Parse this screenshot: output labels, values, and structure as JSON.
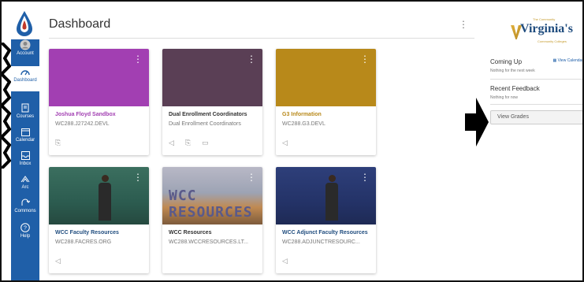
{
  "header": {
    "title": "Dashboard"
  },
  "nav": {
    "items": [
      {
        "label": "Account",
        "icon": "account-icon"
      },
      {
        "label": "Dashboard",
        "icon": "dashboard-icon"
      },
      {
        "label": "Courses",
        "icon": "courses-icon"
      },
      {
        "label": "Calendar",
        "icon": "calendar-icon"
      },
      {
        "label": "Inbox",
        "icon": "inbox-icon"
      },
      {
        "label": "Arc",
        "icon": "arc-icon"
      },
      {
        "label": "Commons",
        "icon": "commons-icon"
      },
      {
        "label": "Help",
        "icon": "help-icon"
      }
    ]
  },
  "cards": [
    {
      "name": "Joshua Floyd Sandbox",
      "code": "WC288.J27242.DEVL",
      "color": "#a23fb2",
      "name_color": "#a23fb2"
    },
    {
      "name": "Dual Enrollment Coordinators",
      "code": "Dual Enrollment Coordinators",
      "color": "#5a3f55",
      "name_color": "#333333"
    },
    {
      "name": "G3 Information",
      "code": "WC288.G3.DEVL",
      "color": "#b8891a",
      "name_color": "#b8891a"
    },
    {
      "name": "WCC Faculty Resources",
      "code": "WC288.FACRES.ORG",
      "color": "#2c5c50",
      "name_color": "#1f4c7e"
    },
    {
      "name": "WCC Resources",
      "code": "WC288.WCCRESOURCES.LT...",
      "color": "#9da3b4",
      "name_color": "#333333",
      "banner_text": "WCC RESOURCES"
    },
    {
      "name": "WCC Adjunct Faculty Resources",
      "code": "WC288.ADJUNCTRESOURC...",
      "color": "#243368",
      "name_color": "#1f4c7e"
    }
  ],
  "sidebar": {
    "brand_top": "The Community",
    "brand_word": "Virginia's",
    "brand_sub": "Community Colleges",
    "coming_up": {
      "title": "Coming Up",
      "link": "View Calendar",
      "text": "Nothing for the next week"
    },
    "recent_feedback": {
      "title": "Recent Feedback",
      "text": "Nothing for now"
    },
    "view_grades": "View Grades"
  }
}
